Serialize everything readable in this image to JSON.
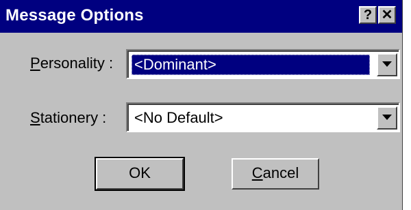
{
  "window": {
    "title": "Message Options",
    "help_label": "?",
    "close_label": "✕"
  },
  "personality": {
    "label_mnemonic": "P",
    "label_rest": "ersonality :",
    "value": "<Dominant>"
  },
  "stationery": {
    "label_mnemonic": "S",
    "label_rest": "tationery :",
    "value": "<No Default>"
  },
  "buttons": {
    "ok_label": "OK",
    "cancel_mnemonic": "C",
    "cancel_rest": "ancel"
  },
  "colors": {
    "titlebar": "#000080",
    "face": "#c0c0c0",
    "selection": "#000080"
  }
}
